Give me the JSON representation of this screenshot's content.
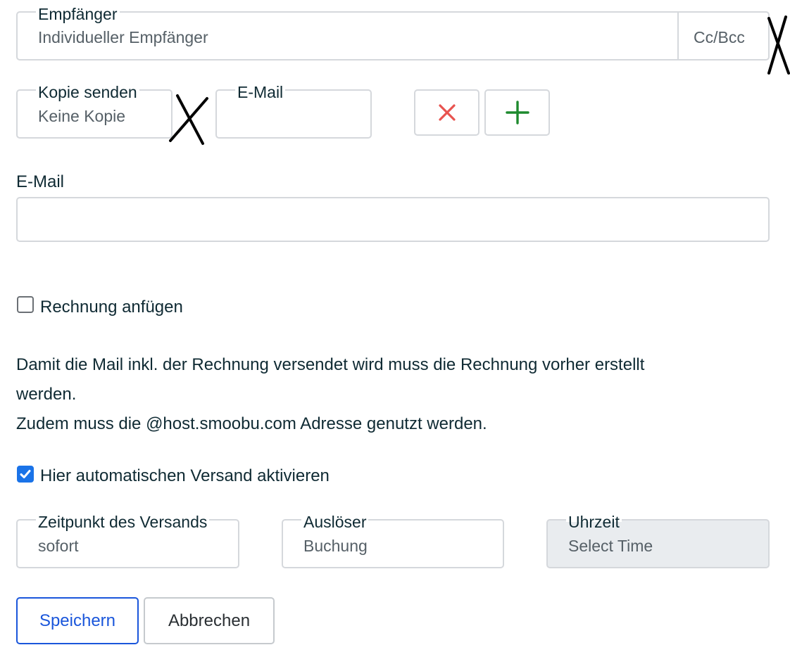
{
  "recipient": {
    "label": "Empfänger",
    "value": "Individueller Empfänger",
    "ccbcc": "Cc/Bcc"
  },
  "copy": {
    "label": "Kopie senden",
    "value": "Keine Kopie",
    "email_label": "E-Mail",
    "email_value": ""
  },
  "email": {
    "label": "E-Mail",
    "value": ""
  },
  "invoice": {
    "label": "Rechnung anfügen",
    "checked": false
  },
  "info": {
    "line1": "Damit die Mail inkl. der Rechnung versendet wird muss die Rechnung vorher erstellt",
    "line2": "werden.",
    "line3": "Zudem muss die @host.smoobu.com Adresse genutzt werden."
  },
  "auto_send": {
    "label": "Hier automatischen Versand aktivieren",
    "checked": true
  },
  "schedule": {
    "time_label": "Zeitpunkt des Versands",
    "time_value": "sofort",
    "trigger_label": "Auslöser",
    "trigger_value": "Buchung",
    "clock_label": "Uhrzeit",
    "clock_placeholder": "Select Time"
  },
  "actions": {
    "save": "Speichern",
    "cancel": "Abbrechen"
  },
  "colors": {
    "remove": "#e8534f",
    "add": "#1e8a2e",
    "primary": "#1a56db"
  },
  "icons": {
    "remove": "close-icon",
    "add": "plus-icon"
  }
}
